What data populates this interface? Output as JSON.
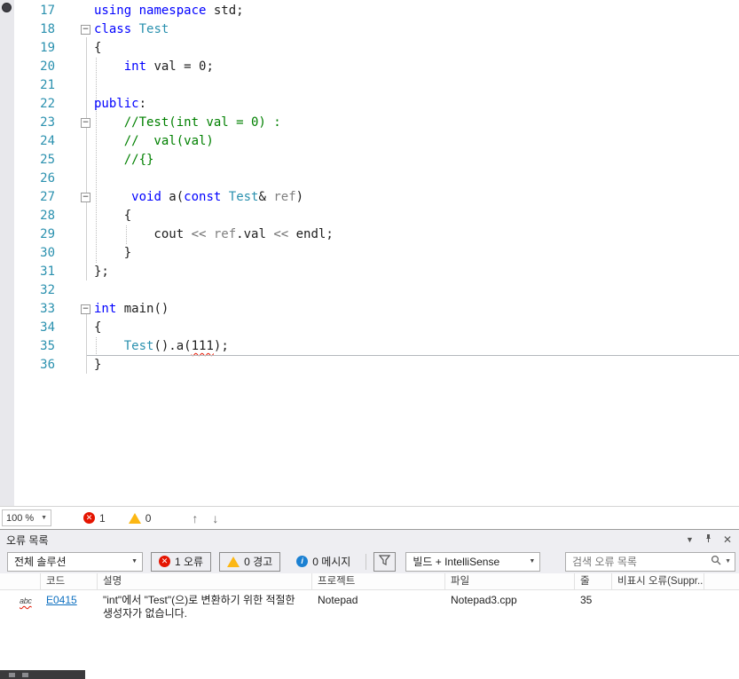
{
  "colors": {
    "kw": "#0000ff",
    "type": "#2b91af",
    "comment": "#008000",
    "plain": "#1e1e1e",
    "param": "#808080",
    "op": "#6e6e6e",
    "lineNumber": "#2b91af",
    "errorLink": "#0e70c0"
  },
  "editor": {
    "lines": [
      {
        "n": "17",
        "segs": [
          [
            "kw",
            "using"
          ],
          [
            "pl",
            " "
          ],
          [
            "kw",
            "namespace"
          ],
          [
            "pl",
            " std;"
          ]
        ]
      },
      {
        "n": "18",
        "collapse": true,
        "segs": [
          [
            "kw",
            "class"
          ],
          [
            "pl",
            " "
          ],
          [
            "type",
            "Test"
          ]
        ]
      },
      {
        "n": "19",
        "segs": [
          [
            "pl",
            "{"
          ]
        ]
      },
      {
        "n": "20",
        "segs": [
          [
            "pl",
            "    "
          ],
          [
            "kw",
            "int"
          ],
          [
            "pl",
            " val = 0;"
          ]
        ]
      },
      {
        "n": "21",
        "segs": []
      },
      {
        "n": "22",
        "segs": [
          [
            "kw",
            "public"
          ],
          [
            "pl",
            ":"
          ]
        ]
      },
      {
        "n": "23",
        "collapse": true,
        "segs": [
          [
            "pl",
            "    "
          ],
          [
            "cm",
            "//Test(int val = 0) :"
          ]
        ]
      },
      {
        "n": "24",
        "segs": [
          [
            "pl",
            "    "
          ],
          [
            "cm",
            "//  val(val)"
          ]
        ]
      },
      {
        "n": "25",
        "segs": [
          [
            "pl",
            "    "
          ],
          [
            "cm",
            "//{}"
          ]
        ]
      },
      {
        "n": "26",
        "segs": []
      },
      {
        "n": "27",
        "collapse": true,
        "segs": [
          [
            "pl",
            "     "
          ],
          [
            "kw",
            "void"
          ],
          [
            "pl",
            " a("
          ],
          [
            "kw",
            "const"
          ],
          [
            "pl",
            " "
          ],
          [
            "type",
            "Test"
          ],
          [
            "pl",
            "& "
          ],
          [
            "pm",
            "ref"
          ],
          [
            "pl",
            ")"
          ]
        ]
      },
      {
        "n": "28",
        "segs": [
          [
            "pl",
            "    {"
          ]
        ]
      },
      {
        "n": "29",
        "segs": [
          [
            "pl",
            "        cout "
          ],
          [
            "op",
            "<<"
          ],
          [
            "pl",
            " "
          ],
          [
            "pm",
            "ref"
          ],
          [
            "pl",
            ".val "
          ],
          [
            "op",
            "<<"
          ],
          [
            "pl",
            " endl;"
          ]
        ]
      },
      {
        "n": "30",
        "segs": [
          [
            "pl",
            "    }"
          ]
        ]
      },
      {
        "n": "31",
        "segs": [
          [
            "pl",
            "};"
          ]
        ]
      },
      {
        "n": "32",
        "segs": []
      },
      {
        "n": "33",
        "collapse": true,
        "segs": [
          [
            "kw",
            "int"
          ],
          [
            "pl",
            " main()"
          ]
        ]
      },
      {
        "n": "34",
        "segs": [
          [
            "pl",
            "{"
          ]
        ]
      },
      {
        "n": "35",
        "current": true,
        "segs": [
          [
            "pl",
            "    "
          ],
          [
            "type",
            "Test"
          ],
          [
            "pl",
            "().a("
          ],
          [
            "sq",
            "111"
          ],
          [
            "pl",
            ");"
          ]
        ]
      },
      {
        "n": "36",
        "segs": [
          [
            "pl",
            "}"
          ]
        ]
      }
    ]
  },
  "statusbar": {
    "zoom": "100 %",
    "errors": "1",
    "warnings": "0"
  },
  "errorList": {
    "title": "오류 목록",
    "scope": "전체 솔루션",
    "errorsBtn": "1 오류",
    "warningsBtn": "0 경고",
    "messagesBtn": "0 메시지",
    "buildFilter": "빌드 + IntelliSense",
    "searchPlaceholder": "검색 오류 목록",
    "columns": [
      "코드",
      "설명",
      "프로젝트",
      "파일",
      "줄",
      "비표시 오류(Suppr..."
    ],
    "rows": [
      {
        "icon": "abc",
        "code": "E0415",
        "description": "\"int\"에서 \"Test\"(으)로 변환하기 위한 적절한 생성자가 없습니다.",
        "project": "Notepad",
        "file": "Notepad3.cpp",
        "line": "35"
      }
    ]
  }
}
